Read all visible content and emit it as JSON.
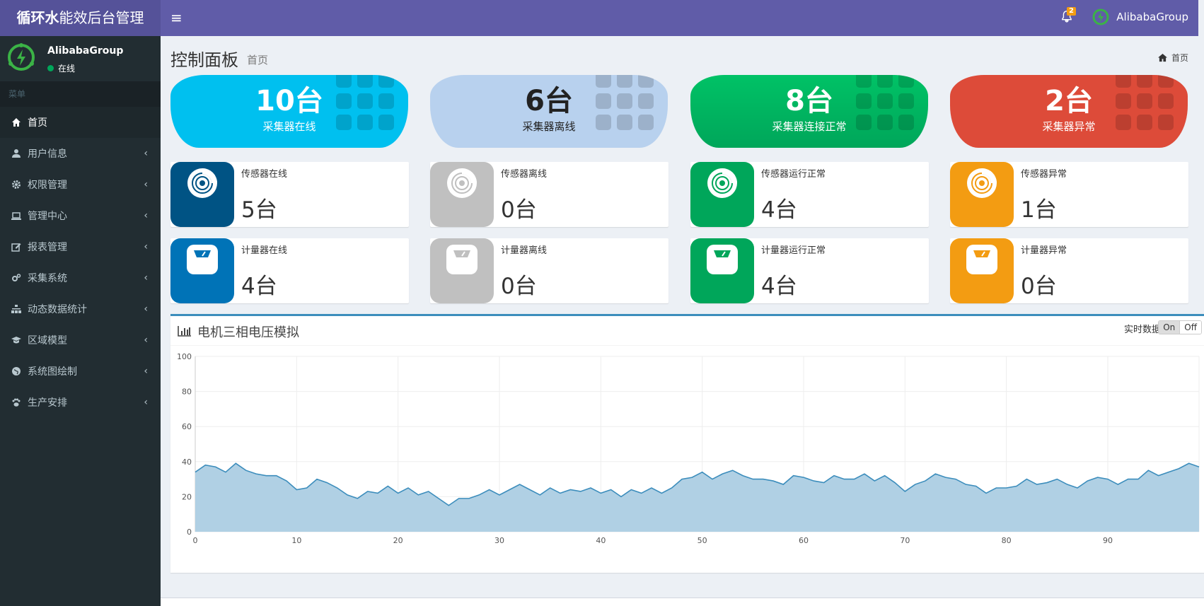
{
  "app": {
    "logo_bold": "循环水",
    "logo_rest": "能效后台管理",
    "notification_count": "2",
    "user_name": "AlibabaGroup",
    "user_status": "在线"
  },
  "sidebar": {
    "header": "菜单",
    "items": [
      {
        "label": "首页",
        "icon": "home-icon",
        "active": true
      },
      {
        "label": "用户信息",
        "icon": "user-icon"
      },
      {
        "label": "权限管理",
        "icon": "gear-icon"
      },
      {
        "label": "管理中心",
        "icon": "laptop-icon"
      },
      {
        "label": "报表管理",
        "icon": "edit-icon"
      },
      {
        "label": "采集系统",
        "icon": "gears-icon"
      },
      {
        "label": "动态数据统计",
        "icon": "sitemap-icon"
      },
      {
        "label": "区域模型",
        "icon": "graduation-cap-icon"
      },
      {
        "label": "系统图绘制",
        "icon": "globe-icon"
      },
      {
        "label": "生产安排",
        "icon": "paw-icon"
      }
    ]
  },
  "page": {
    "title": "控制面板",
    "subtitle": "首页",
    "breadcrumb": "首页"
  },
  "pills": [
    {
      "value": "10台",
      "label": "采集器在线",
      "color": "#00c0ef"
    },
    {
      "value": "6台",
      "label": "采集器离线",
      "color": "#b8d1ee"
    },
    {
      "value": "8台",
      "label": "采集器连接正常",
      "color": "#00b760"
    },
    {
      "value": "2台",
      "label": "采集器异常",
      "color": "#dd4b39"
    }
  ],
  "sensors": [
    {
      "label": "传感器在线",
      "value": "5台",
      "color": "#005384"
    },
    {
      "label": "传感器离线",
      "value": "0台",
      "color": "#c0c0c0"
    },
    {
      "label": "传感器运行正常",
      "value": "4台",
      "color": "#00a65a"
    },
    {
      "label": "传感器异常",
      "value": "1台",
      "color": "#f39c12"
    }
  ],
  "meters": [
    {
      "label": "计量器在线",
      "value": "4台",
      "color": "#0073b7"
    },
    {
      "label": "计量器离线",
      "value": "0台",
      "color": "#c0c0c0"
    },
    {
      "label": "计量器运行正常",
      "value": "4台",
      "color": "#00a65a"
    },
    {
      "label": "计量器异常",
      "value": "0台",
      "color": "#f39c12"
    }
  ],
  "chart": {
    "title": "电机三相电压模拟",
    "realtime_label": "实时数据",
    "on_label": "On",
    "off_label": "Off"
  },
  "chart_data": {
    "type": "area",
    "title": "电机三相电压模拟",
    "xlim": [
      0,
      99
    ],
    "ylim": [
      0,
      100
    ],
    "x_ticks": [
      0,
      10,
      20,
      30,
      40,
      50,
      60,
      70,
      80,
      90
    ],
    "y_ticks": [
      0,
      20,
      40,
      60,
      80,
      100
    ],
    "grid": true,
    "color": "#3c8dbc",
    "fill": "#b0d0e4",
    "x": [
      0,
      1,
      2,
      3,
      4,
      5,
      6,
      7,
      8,
      9,
      10,
      11,
      12,
      13,
      14,
      15,
      16,
      17,
      18,
      19,
      20,
      21,
      22,
      23,
      24,
      25,
      26,
      27,
      28,
      29,
      30,
      31,
      32,
      33,
      34,
      35,
      36,
      37,
      38,
      39,
      40,
      41,
      42,
      43,
      44,
      45,
      46,
      47,
      48,
      49,
      50,
      51,
      52,
      53,
      54,
      55,
      56,
      57,
      58,
      59,
      60,
      61,
      62,
      63,
      64,
      65,
      66,
      67,
      68,
      69,
      70,
      71,
      72,
      73,
      74,
      75,
      76,
      77,
      78,
      79,
      80,
      81,
      82,
      83,
      84,
      85,
      86,
      87,
      88,
      89,
      90,
      91,
      92,
      93,
      94,
      95,
      96,
      97,
      98,
      99
    ],
    "y": [
      34,
      38,
      37,
      34,
      39,
      35,
      33,
      32,
      32,
      29,
      24,
      25,
      30,
      28,
      25,
      21,
      19,
      23,
      22,
      26,
      22,
      25,
      21,
      23,
      19,
      15,
      19,
      19,
      21,
      24,
      21,
      24,
      27,
      24,
      21,
      25,
      22,
      24,
      23,
      25,
      22,
      24,
      20,
      24,
      22,
      25,
      22,
      25,
      30,
      31,
      34,
      30,
      33,
      35,
      32,
      30,
      30,
      29,
      27,
      32,
      31,
      29,
      28,
      32,
      30,
      30,
      33,
      29,
      32,
      28,
      23,
      27,
      29,
      33,
      31,
      30,
      27,
      26,
      22,
      25,
      25,
      26,
      30,
      27,
      28,
      30,
      27,
      25,
      29,
      31,
      30,
      27,
      30,
      30,
      35,
      32,
      34,
      36,
      39,
      37
    ]
  }
}
